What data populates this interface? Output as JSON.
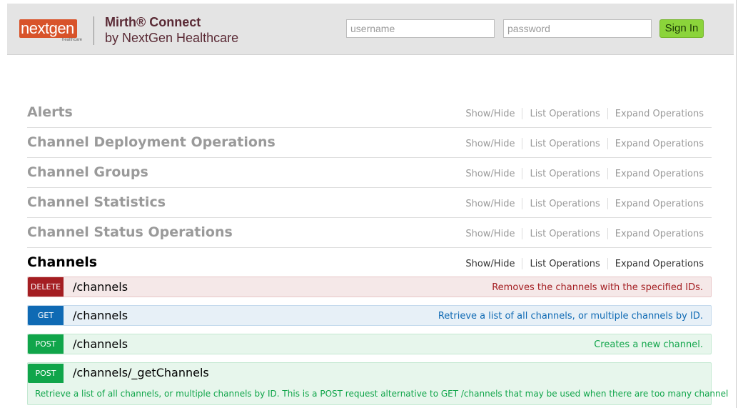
{
  "header": {
    "logo_text": "nextgen",
    "logo_sub": "healthcare",
    "product_name": "Mirth® Connect",
    "product_sub": "by NextGen Healthcare",
    "username_placeholder": "username",
    "password_placeholder": "password",
    "signin_label": "Sign In"
  },
  "ops_labels": {
    "show_hide": "Show/Hide",
    "list_operations": "List Operations",
    "expand_operations": "Expand Operations"
  },
  "resources": [
    {
      "name": "Alerts"
    },
    {
      "name": "Channel Deployment Operations"
    },
    {
      "name": "Channel Groups"
    },
    {
      "name": "Channel Statistics"
    },
    {
      "name": "Channel Status Operations"
    },
    {
      "name": "Channels"
    }
  ],
  "endpoints": [
    {
      "method": "DELETE",
      "path": "/channels",
      "summary": "Removes the channels with the specified IDs."
    },
    {
      "method": "GET",
      "path": "/channels",
      "summary": "Retrieve a list of all channels, or multiple channels by ID."
    },
    {
      "method": "POST",
      "path": "/channels",
      "summary": "Creates a new channel."
    },
    {
      "method": "POST",
      "path": "/channels/_getChannels",
      "summary": "",
      "description": "Retrieve a list of all channels, or multiple channels by ID. This is a POST request alternative to GET /channels that may be used when there are too many channel"
    }
  ],
  "colors": {
    "delete": "#a41e22",
    "get": "#0f6ab4",
    "post": "#10a54a",
    "signin": "#8bd43a",
    "brand": "#d8532a"
  }
}
